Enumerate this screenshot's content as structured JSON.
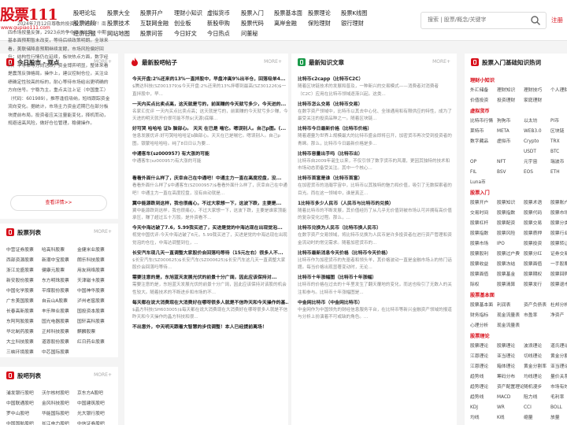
{
  "logo": {
    "title": "股票111",
    "url": "www.gupiao111.com"
  },
  "nav": [
    [
      "股吧论坛",
      "股票进阶",
      "经济日报"
    ],
    [
      "股票大全",
      "股票技术",
      "网站地图"
    ],
    [
      "股票开户",
      "互联网金融",
      "股票问答"
    ],
    [
      "理财小知识",
      "创业板",
      "今日好文"
    ],
    [
      "虚拟货币",
      "新股申购",
      "今日热点"
    ],
    [
      "股票入门",
      "股票代码",
      "问董秘"
    ],
    [
      "股票基本面",
      "离岸金融"
    ],
    [
      "股票理论",
      "保险理财"
    ],
    [
      "股票K线图",
      "银行理财"
    ]
  ],
  "search": {
    "placeholder": "搜索 | 股票/概念/关键字"
  },
  "register": "注册",
  "panels": {
    "daily": {
      "title": "今日股市 - 观点",
      "more": "MORE+",
      "summary": "2024年7月12日尊敬的投资者：早上好！南四市场按量反弹，2923点的争夺尚未结束，中期基本面预期暂未改变，等待后续政策明朗。全球来看，美联储降息预期继续发酵，市场风险偏好回升；结构性行情仍在延续，板块热点方面，数字经济、半导体等方向活跃，资金博弈明显，整体来看是震荡反弹格局。操作上，建议控制仓位，关注业绩确定性较高的标的，耐心等待市场给出更明确的方向信号。宁稳为主，重点关注上证（中国重工）（代码：601989），推荐逢低吸纳，短线跟踪资金流向变化。据统计，市场主力资金近期已在部分板块提前布局，投资者应关注量能变化，择机而动，规避追高风险，做好仓位管理，稳健操作。",
      "button": "查看详情>>"
    },
    "ranking": {
      "title": "股票列表",
      "more": "MORE+",
      "items": [
        [
          "中营证券股票",
          "哈高科股票",
          "金健米业股票"
        ],
        [
          "西部资源股票",
          "新潮中宝股票",
          "朗乐科技股票"
        ],
        [
          "浙江龙盛股票",
          "健康元股票",
          "用友网络股票"
        ],
        [
          "新安股份股票",
          "东方明珠股票",
          "天津磁卡股票"
        ],
        [
          "中国化学股票",
          "平煤股份股票",
          "中国神华股票"
        ],
        [
          "广东美国股票",
          "自云山A股票",
          "泸州老窖股票"
        ],
        [
          "长春高新股票",
          "丰乐种业股票",
          "国投资本股票"
        ],
        [
          "东阿阿胶股票",
          "国光电器股票",
          "国轩高科股票"
        ],
        [
          "华北制药股票",
          "正邦科技股票",
          "麒麟股票"
        ],
        [
          "大立科技股票",
          "道恩股份股票",
          "红日药业股票"
        ],
        [
          "三峡环境股票",
          "中芯国际股票",
          ""
        ]
      ]
    },
    "bars": {
      "title": "股吧列表",
      "more": "MORE+",
      "items": [
        [
          "浦发银行股吧",
          "沃尔核材股吧",
          "京东方A股吧"
        ],
        [
          "中国联通股吧",
          "金风科技股吧",
          "中国建筑股吧"
        ],
        [
          "罗中山股吧",
          "华能国际股吧",
          "光大银行股吧"
        ],
        [
          "中国国航股吧",
          "长江电力股吧",
          "中信证券股吧"
        ]
      ]
    },
    "hot": {
      "title": "最新股吧帖子",
      "more": "MORE+",
      "items": [
        {
          "t": "今天开盘:2%还来的13%一直拌股中，早盘冲高9%出半仓，回落吸单4...",
          "d": "$腾达科技(SZ001379)$今天开盘:2%还来的13%拌哪到最高(SZ301226)$一直拌股中，早..."
        },
        {
          "t": "一天内买点比卖点高，这天就是亏的，前面赚的今天就亏多少，今天进的...",
          "d": "名家汇优评 一天内买点比卖点高；这天就是亏的，前面赚的今天就亏多少赚，今天进的明天就开价很可能不然$(天源)底曝..."
        },
        {
          "t": "好可哭 哈哈哈 证b 脑部心。 天天 在已是 喘它。嗯误别人。自己p图。(...",
          "d": "信息发展优评:好可哭哈哈哈证b脑部心。天天在已是喘它。嗯误别人。自己p图。银蒙哈哈哈哈。纯了8日日认为要..."
        },
        {
          "t": "中通客车(sz000957) 有大涨的可能",
          "d": "中通客车(sz000957)有大涨的可能"
        },
        {
          "t": "看看外面什么样了，庆幸自己在中通吧！中通主力一直在高度控盘，没...",
          "d": "看看外面什么样了$中通客车(SZ000957)$看看外面什么样了，庆幸自己在中通吧！中通主力一直在高度控盘，没有自动就是..."
        },
        {
          "t": "翼中能源跌到这样，我也很痛心，不过大家想一下，这波下跌，主要是...",
          "d": "翼中能源跌到这样，我也很痛心，不过大家想一下，这波下跌，主要是谁家顶能承压，赚了超过五十万股。是外资看不..."
        },
        {
          "t": "今天中海达破了7.6，5.99我买进了，买进是觉的中海达现在出现觉泡...",
          "d": "视觉中国优评:今天中海达破了6元，5.99我买进了，买进是觉的中海达现在出现觉泡的仓位，中海达调整到位，..."
        },
        {
          "t": "长安汽车现几天一直调整大家股价会回落吗等待（15元左右）很多人不...",
          "d": "$长安汽车(SZ000625)$长安汽车(SZ000625)$长安汽车这几天一直调整大家股价会回落吗等待..."
        },
        {
          "t": "需要注意的是，东旭蓝天发展光伏的前景十分广阔，因此应该保持对...",
          "d": "需要注意的是，东旭蓝天发展光伏的前景十分广阔，因此应该保持对该股的机会性较大。随着技术的不断进步和市场的不..."
        },
        {
          "t": "每天都在说大消费现在大消费好在哪呀很多人就是不信昨天和今天操作的基...",
          "d": "$晶方科技(SH603005)$每天都在说大消费现在大消费好在哪呀很多人就是不信昨天和今天操作的晶方科技和很..."
        },
        {
          "t": "不出意外，中天明天跟着大智慧的步伐调整！本人已经提前离场！",
          "d": ""
        }
      ]
    },
    "knowledge": {
      "title": "最新知识文章",
      "more": "MORE+",
      "items": [
        {
          "t": "比特币c2capp（比特币C2C）",
          "d": "随着区块链技术的发展和普及，一种新兴的交易模式——消费者对消费者（C2C）应用在比特币领域逐渐兴起。这类..."
        },
        {
          "t": "比特币怎么交易（比特币交易）",
          "d": "在数字资产领域中，比特币以其去中心化、全球通用和有限供应的特性，成为了最受关注的投资品种之一。随着区块链..."
        },
        {
          "t": "比特币今日最新价格（比特币价格）",
          "d": "随着避量为世界上规模最大的比特币盛会即将召开，加密货币再次受到投资者的青睐。那么，比特币今日最新价格是多..."
        },
        {
          "t": "比特币容量出手吗（比特币出）",
          "d": "比特币自2009年诞生以来，不仅引领了数字货币的风潮，更因其独特的技术和市场动态而备受关注。其中一个核心..."
        },
        {
          "t": "比特币首富是谁（比特币首富）",
          "d": "在加密货币的浩瀚宇宙中，比特币以其独特的魅力和价值，吸引了无数探索者的目光。而在这一领域中，谁是真正..."
        },
        {
          "t": "1比特币多少人民币（人民币与比特币的兑换）",
          "d": "随着比特币的不断发展，其价值经历了从几乎无价值到被市场认可并拥有高价值的复杂变化过程。那么，..."
        },
        {
          "t": "比特币兑换为人民币（比特币换人民币）",
          "d": "在数字资产交易领域，将比特币兑换为人民币是许多投资者在进行资产管理和资金流动时的常见需求。随着加密货币的..."
        },
        {
          "t": "比特币最新消息今天价格（比特币今天价格）",
          "d": "比特币作为加密货币的先驱者和领头羊，其价格波动一直是金融市场上的热门话题。每当价格出现显著变动时，无论..."
        },
        {
          "t": "比特币十年涨幅图（比特币十年涨幅）",
          "d": "比特币的价格在过去的十年里发生了翻天覆地的变化，而这也吸引了无数人的关注和参与。比特币十年涨幅图是..."
        },
        {
          "t": "中金网比特币（中金网比特币）",
          "d": "中金网作为中国领先的财经信息服务平台，在比特币等新兴金融资产领域的报道与分析上扮演着不可或缺的角色。..."
        }
      ]
    },
    "basics": {
      "title": "股票入门基础知识热词",
      "more": "MORE+",
      "sections": [
        {
          "label": "理财小知识",
          "rows": [
            [
              "外汇储备",
              "理财知识",
              "理财技巧",
              "个人理财"
            ],
            [
              "价值投资",
              "投资理财",
              "家庭理财",
              ""
            ]
          ]
        },
        {
          "label": "虚拟货币",
          "rows": [
            [
              "比特币行情",
              "狗狗币",
              "以太坊",
              "PI币"
            ],
            [
              "莱特币",
              "META",
              "WEB3.0",
              "区块链"
            ],
            [
              "数字藏品",
              "虚拟币",
              "Crypto",
              "TRX"
            ],
            [
              "",
              "",
              "USDT",
              "BTC"
            ],
            [
              "OP",
              "NFT",
              "元宇宙",
              "瑞波币"
            ],
            [
              "FIL",
              "BSV",
              "EOS",
              "ETH"
            ],
            [
              "Luna币",
              "",
              "",
              ""
            ]
          ]
        },
        {
          "label": "股票入门",
          "rows": [
            [
              "股票开户",
              "股票知识",
              "股票术语",
              "股票账户"
            ],
            [
              "交易时间",
              "股票指数",
              "股票代码",
              "股票市场"
            ],
            [
              "股票杠杆",
              "股票配资",
              "股票交易",
              "股票分类"
            ],
            [
              "股票指数",
              "股票风险",
              "股票质押",
              "股票行业"
            ],
            [
              "股票市场",
              "IPO",
              "股票投资",
              "股票转让"
            ],
            [
              "股票股利",
              "股票过户费",
              "股票分红",
              "证券交易"
            ],
            [
              "股票收益",
              "股票冻结",
              "股票面值",
              "一手股票"
            ],
            [
              "股票面值",
              "股票基金",
              "股票期权",
              "股票回购"
            ],
            [
              "除权",
              "股票清算",
              "股票发行",
              "股票退市"
            ]
          ]
        },
        {
          "label": "股票基本面",
          "rows": [
            [
              "股票基本面",
              "利润表",
              "资产负债表",
              "杜邦分析"
            ],
            [
              "财务指标",
              "现金流量表",
              "市盈率",
              "净资产"
            ],
            [
              "心理分析",
              "现金流量表",
              "",
              ""
            ]
          ]
        },
        {
          "label": "股票理论",
          "rows": [
            [
              "股票理论",
              "股票理论",
              "波浪理论",
              "道氏理论"
            ],
            [
              "江恩理论",
              "亚当理论",
              "切线理论",
              "黄金分割"
            ],
            [
              "江恩理论",
              "箱体理论",
              "黄金分割率",
              "亚当理论"
            ],
            [
              "趋势线",
              "筹码分布",
              "均线理论",
              "量价关系"
            ],
            [
              "趋势理论",
              "资产配置理论",
              "随机漫步",
              "市场有效"
            ],
            [
              "趋势线",
              "MACD",
              "阻力线",
              "毛利率"
            ],
            [
              "KDJ",
              "WR",
              "CCI",
              "BOLL"
            ],
            [
              "均线",
              "K线",
              "缩量",
              "放量"
            ]
          ]
        }
      ]
    }
  }
}
